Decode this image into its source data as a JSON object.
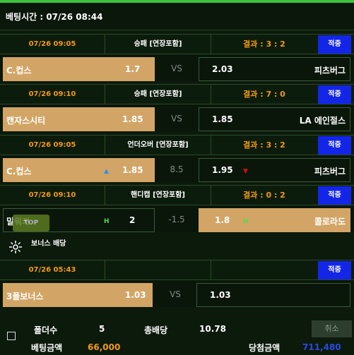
{
  "header": {
    "title": "베팅시간 : 07/26 08:44"
  },
  "games": [
    {
      "time": "07/26 09:05",
      "market": "승패 [연장포함]",
      "result": "결과 : 3 : 2",
      "badge": "적중",
      "home": "C.컵스",
      "home_odds": "1.7",
      "mid": "VS",
      "away_odds": "2.03",
      "away": "피츠버그",
      "selected": "home"
    },
    {
      "time": "07/26 09:10",
      "market": "승패 [연장포함]",
      "result": "결과 : 7 : 0",
      "badge": "적중",
      "home": "캔자스시티",
      "home_odds": "1.85",
      "mid": "VS",
      "away_odds": "1.85",
      "away": "LA 에인절스",
      "selected": "home"
    },
    {
      "time": "07/26 09:05",
      "market": "언더오버 [연장포함]",
      "result": "결과 : 3 : 2",
      "badge": "적중",
      "home": "C.컵스",
      "home_odds": "1.85",
      "mid": "8.5",
      "away_odds": "1.95",
      "away": "피츠버그",
      "selected": "home",
      "home_mark": "▲",
      "away_mark": "▼"
    },
    {
      "time": "07/26 09:10",
      "market": "핸디캡 [연장포함]",
      "result": "결과 : 0 : 2",
      "badge": "적중",
      "home": "밀워키",
      "home_odds": "2",
      "mid": "-1.5",
      "away_odds": "1.8",
      "away": "콜로라도",
      "selected": "away",
      "home_mark": "H",
      "away_mark": "H"
    }
  ],
  "bonus": {
    "label": "보너스 배당",
    "time": "07/26 05:43",
    "badge": "적중",
    "name": "3폴보너스",
    "odds": "1.03",
    "mid": "VS",
    "away_odds": "1.03"
  },
  "top_button": "TOP",
  "footer": {
    "folder_label": "폴더수",
    "folder_value": "5",
    "total_odds_label": "총배당",
    "total_odds_value": "10.78",
    "cancel": "취소",
    "bet_amount_label": "베팅금액",
    "bet_amount_value": "66,000",
    "win_amount_label": "당첨금액",
    "win_amount_value": "711,480"
  },
  "colors": {
    "accent": "#f39a12",
    "selected": "#d2a566",
    "badge": "#1326e8",
    "mark_up": "#2a8fff",
    "mark_down": "#d01010",
    "handicap": "#4ce04c"
  }
}
